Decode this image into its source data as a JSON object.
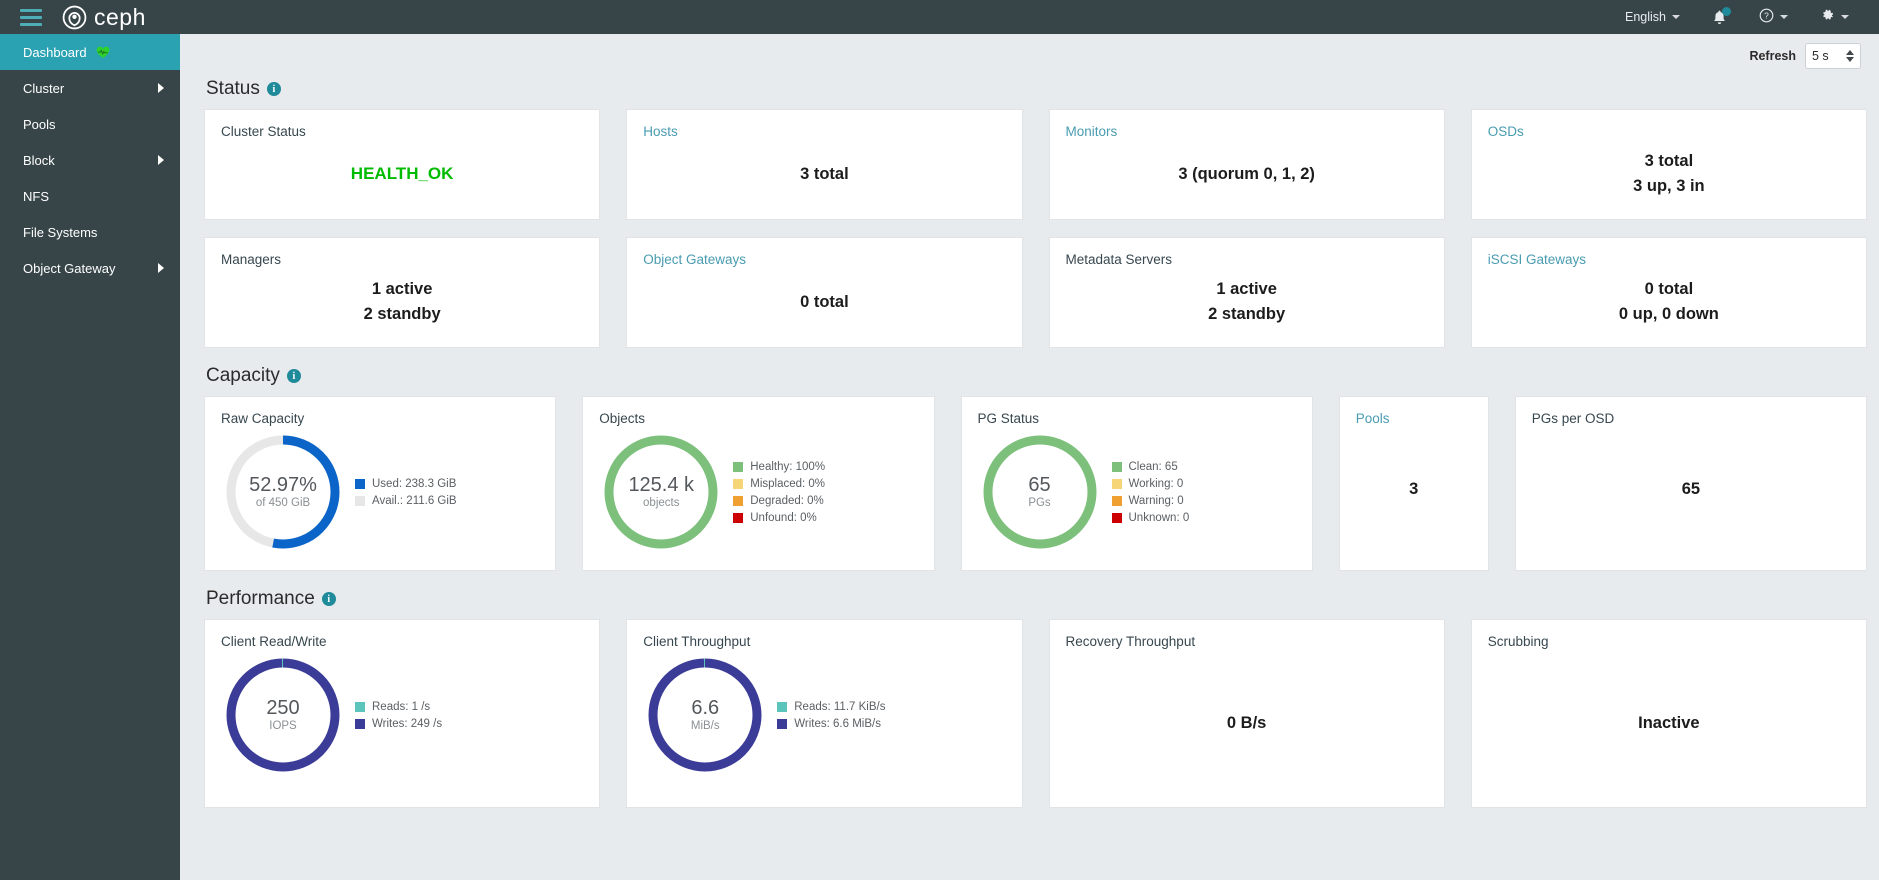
{
  "topbar": {
    "brand": "ceph",
    "menu_icon": "hamburger-icon",
    "language": "English",
    "notifications_icon": "bell-icon",
    "help_icon": "help-circle-icon",
    "settings_icon": "gear-icon"
  },
  "sidebar": {
    "items": [
      {
        "label": "Dashboard",
        "active": true,
        "expandable": false,
        "badge": "heart-pulse-icon"
      },
      {
        "label": "Cluster",
        "active": false,
        "expandable": true
      },
      {
        "label": "Pools",
        "active": false,
        "expandable": false
      },
      {
        "label": "Block",
        "active": false,
        "expandable": true
      },
      {
        "label": "NFS",
        "active": false,
        "expandable": false
      },
      {
        "label": "File Systems",
        "active": false,
        "expandable": false
      },
      {
        "label": "Object Gateway",
        "active": false,
        "expandable": true
      }
    ]
  },
  "refresh": {
    "label": "Refresh",
    "value": "5 s"
  },
  "sections": {
    "status": "Status",
    "capacity": "Capacity",
    "performance": "Performance"
  },
  "status_cards": [
    {
      "title": "Cluster Status",
      "link": false,
      "value": "HEALTH_OK",
      "health": true
    },
    {
      "title": "Hosts",
      "link": true,
      "lines": [
        "3 total"
      ]
    },
    {
      "title": "Monitors",
      "link": true,
      "lines": [
        "3 (quorum 0, 1, 2)"
      ]
    },
    {
      "title": "OSDs",
      "link": true,
      "lines": [
        "3 total",
        "3 up, 3 in"
      ]
    },
    {
      "title": "Managers",
      "link": false,
      "lines": [
        "1 active",
        "2 standby"
      ]
    },
    {
      "title": "Object Gateways",
      "link": true,
      "lines": [
        "0 total"
      ]
    },
    {
      "title": "Metadata Servers",
      "link": false,
      "lines": [
        "1 active",
        "2 standby"
      ]
    },
    {
      "title": "iSCSI Gateways",
      "link": true,
      "lines": [
        "0 total",
        "0 up, 0 down"
      ]
    }
  ],
  "capacity_cards": {
    "raw_capacity": {
      "title": "Raw Capacity",
      "center_main": "52.97%",
      "center_sub": "of 450 GiB",
      "legend": [
        {
          "label": "Used: 238.3 GiB",
          "color": "#0b64c8"
        },
        {
          "label": "Avail.: 211.6 GiB",
          "color": "#e7e7e7"
        }
      ]
    },
    "objects": {
      "title": "Objects",
      "center_main": "125.4 k",
      "center_sub": "objects",
      "legend": [
        {
          "label": "Healthy: 100%",
          "color": "#7cc07c"
        },
        {
          "label": "Misplaced: 0%",
          "color": "#f5d578"
        },
        {
          "label": "Degraded: 0%",
          "color": "#f0a030"
        },
        {
          "label": "Unfound: 0%",
          "color": "#cc0000"
        }
      ]
    },
    "pg_status": {
      "title": "PG Status",
      "center_main": "65",
      "center_sub": "PGs",
      "legend": [
        {
          "label": "Clean: 65",
          "color": "#7cc07c"
        },
        {
          "label": "Working: 0",
          "color": "#f5d578"
        },
        {
          "label": "Warning: 0",
          "color": "#f0a030"
        },
        {
          "label": "Unknown: 0",
          "color": "#cc0000"
        }
      ]
    },
    "pools": {
      "title": "Pools",
      "link": true,
      "value": "3"
    },
    "pgs_per_osd": {
      "title": "PGs per OSD",
      "link": false,
      "value": "65"
    }
  },
  "performance_cards": {
    "client_rw": {
      "title": "Client Read/Write",
      "center_main": "250",
      "center_sub": "IOPS",
      "legend": [
        {
          "label": "Reads: 1 /s",
          "color": "#5bc4bb"
        },
        {
          "label": "Writes: 249 /s",
          "color": "#3b3b98"
        }
      ]
    },
    "client_throughput": {
      "title": "Client Throughput",
      "center_main": "6.6",
      "center_sub": "MiB/s",
      "legend": [
        {
          "label": "Reads: 11.7 KiB/s",
          "color": "#5bc4bb"
        },
        {
          "label": "Writes: 6.6 MiB/s",
          "color": "#3b3b98"
        }
      ]
    },
    "recovery_throughput": {
      "title": "Recovery Throughput",
      "value": "0 B/s"
    },
    "scrubbing": {
      "title": "Scrubbing",
      "value": "Inactive"
    }
  },
  "chart_data": [
    {
      "type": "pie",
      "title": "Raw Capacity",
      "labels": [
        "Used",
        "Avail."
      ],
      "values": [
        238.3,
        211.6
      ],
      "unit": "GiB",
      "total": 450,
      "percent_used": 52.97,
      "colors": [
        "#0b64c8",
        "#e7e7e7"
      ],
      "legend_position": "right"
    },
    {
      "type": "pie",
      "title": "Objects",
      "labels": [
        "Healthy",
        "Misplaced",
        "Degraded",
        "Unfound"
      ],
      "values": [
        100,
        0,
        0,
        0
      ],
      "unit": "%",
      "total": 125400,
      "colors": [
        "#7cc07c",
        "#f5d578",
        "#f0a030",
        "#cc0000"
      ],
      "legend_position": "right"
    },
    {
      "type": "pie",
      "title": "PG Status",
      "labels": [
        "Clean",
        "Working",
        "Warning",
        "Unknown"
      ],
      "values": [
        65,
        0,
        0,
        0
      ],
      "unit": "PGs",
      "total": 65,
      "colors": [
        "#7cc07c",
        "#f5d578",
        "#f0a030",
        "#cc0000"
      ],
      "legend_position": "right"
    },
    {
      "type": "pie",
      "title": "Client Read/Write",
      "labels": [
        "Reads",
        "Writes"
      ],
      "values": [
        1,
        249
      ],
      "unit": "/s",
      "total": 250,
      "colors": [
        "#5bc4bb",
        "#3b3b98"
      ],
      "legend_position": "right"
    },
    {
      "type": "pie",
      "title": "Client Throughput",
      "labels": [
        "Reads",
        "Writes"
      ],
      "values": [
        0.0114,
        6.6
      ],
      "unit": "MiB/s",
      "total": 6.6,
      "colors": [
        "#5bc4bb",
        "#3b3b98"
      ],
      "legend_position": "right"
    }
  ]
}
